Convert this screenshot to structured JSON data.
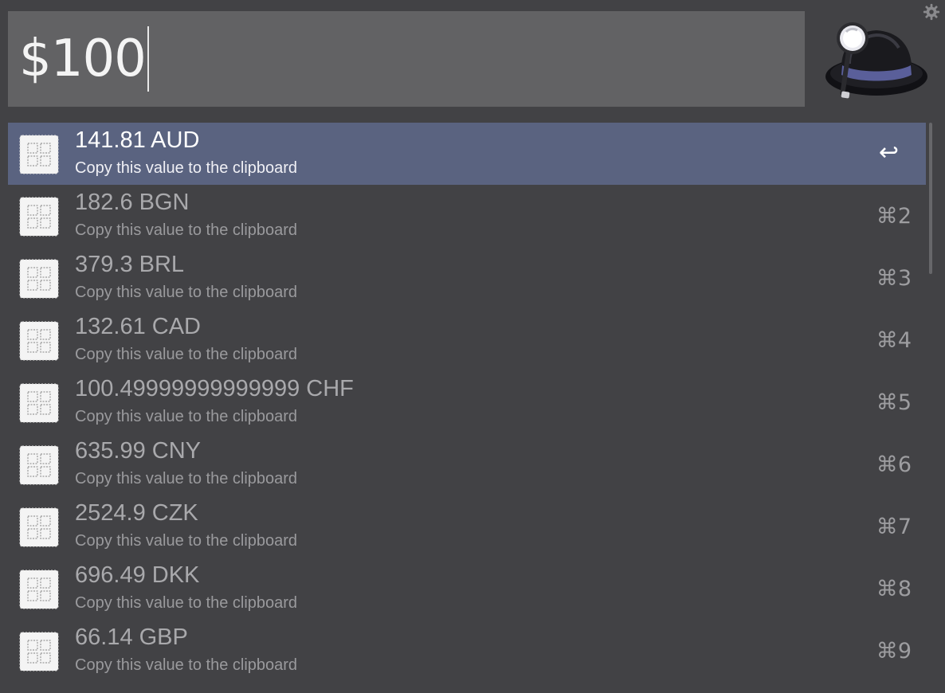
{
  "search": {
    "query": "$100"
  },
  "settings": {
    "icon": "gear-icon"
  },
  "logo": {
    "icon": "alfred-hat-magnifier-logo"
  },
  "results": [
    {
      "title": "141.81 AUD",
      "subtitle": "Copy this value to the clipboard",
      "shortcut": "↩",
      "selected": true
    },
    {
      "title": "182.6 BGN",
      "subtitle": "Copy this value to the clipboard",
      "shortcut": "⌘2",
      "selected": false
    },
    {
      "title": "379.3 BRL",
      "subtitle": "Copy this value to the clipboard",
      "shortcut": "⌘3",
      "selected": false
    },
    {
      "title": "132.61 CAD",
      "subtitle": "Copy this value to the clipboard",
      "shortcut": "⌘4",
      "selected": false
    },
    {
      "title": "100.49999999999999 CHF",
      "subtitle": "Copy this value to the clipboard",
      "shortcut": "⌘5",
      "selected": false
    },
    {
      "title": "635.99 CNY",
      "subtitle": "Copy this value to the clipboard",
      "shortcut": "⌘6",
      "selected": false
    },
    {
      "title": "2524.9 CZK",
      "subtitle": "Copy this value to the clipboard",
      "shortcut": "⌘7",
      "selected": false
    },
    {
      "title": "696.49 DKK",
      "subtitle": "Copy this value to the clipboard",
      "shortcut": "⌘8",
      "selected": false
    },
    {
      "title": "66.14 GBP",
      "subtitle": "Copy this value to the clipboard",
      "shortcut": "⌘9",
      "selected": false
    }
  ],
  "colors": {
    "background": "#424245",
    "search_field": "#626264",
    "selected_row": "#5a6380"
  }
}
